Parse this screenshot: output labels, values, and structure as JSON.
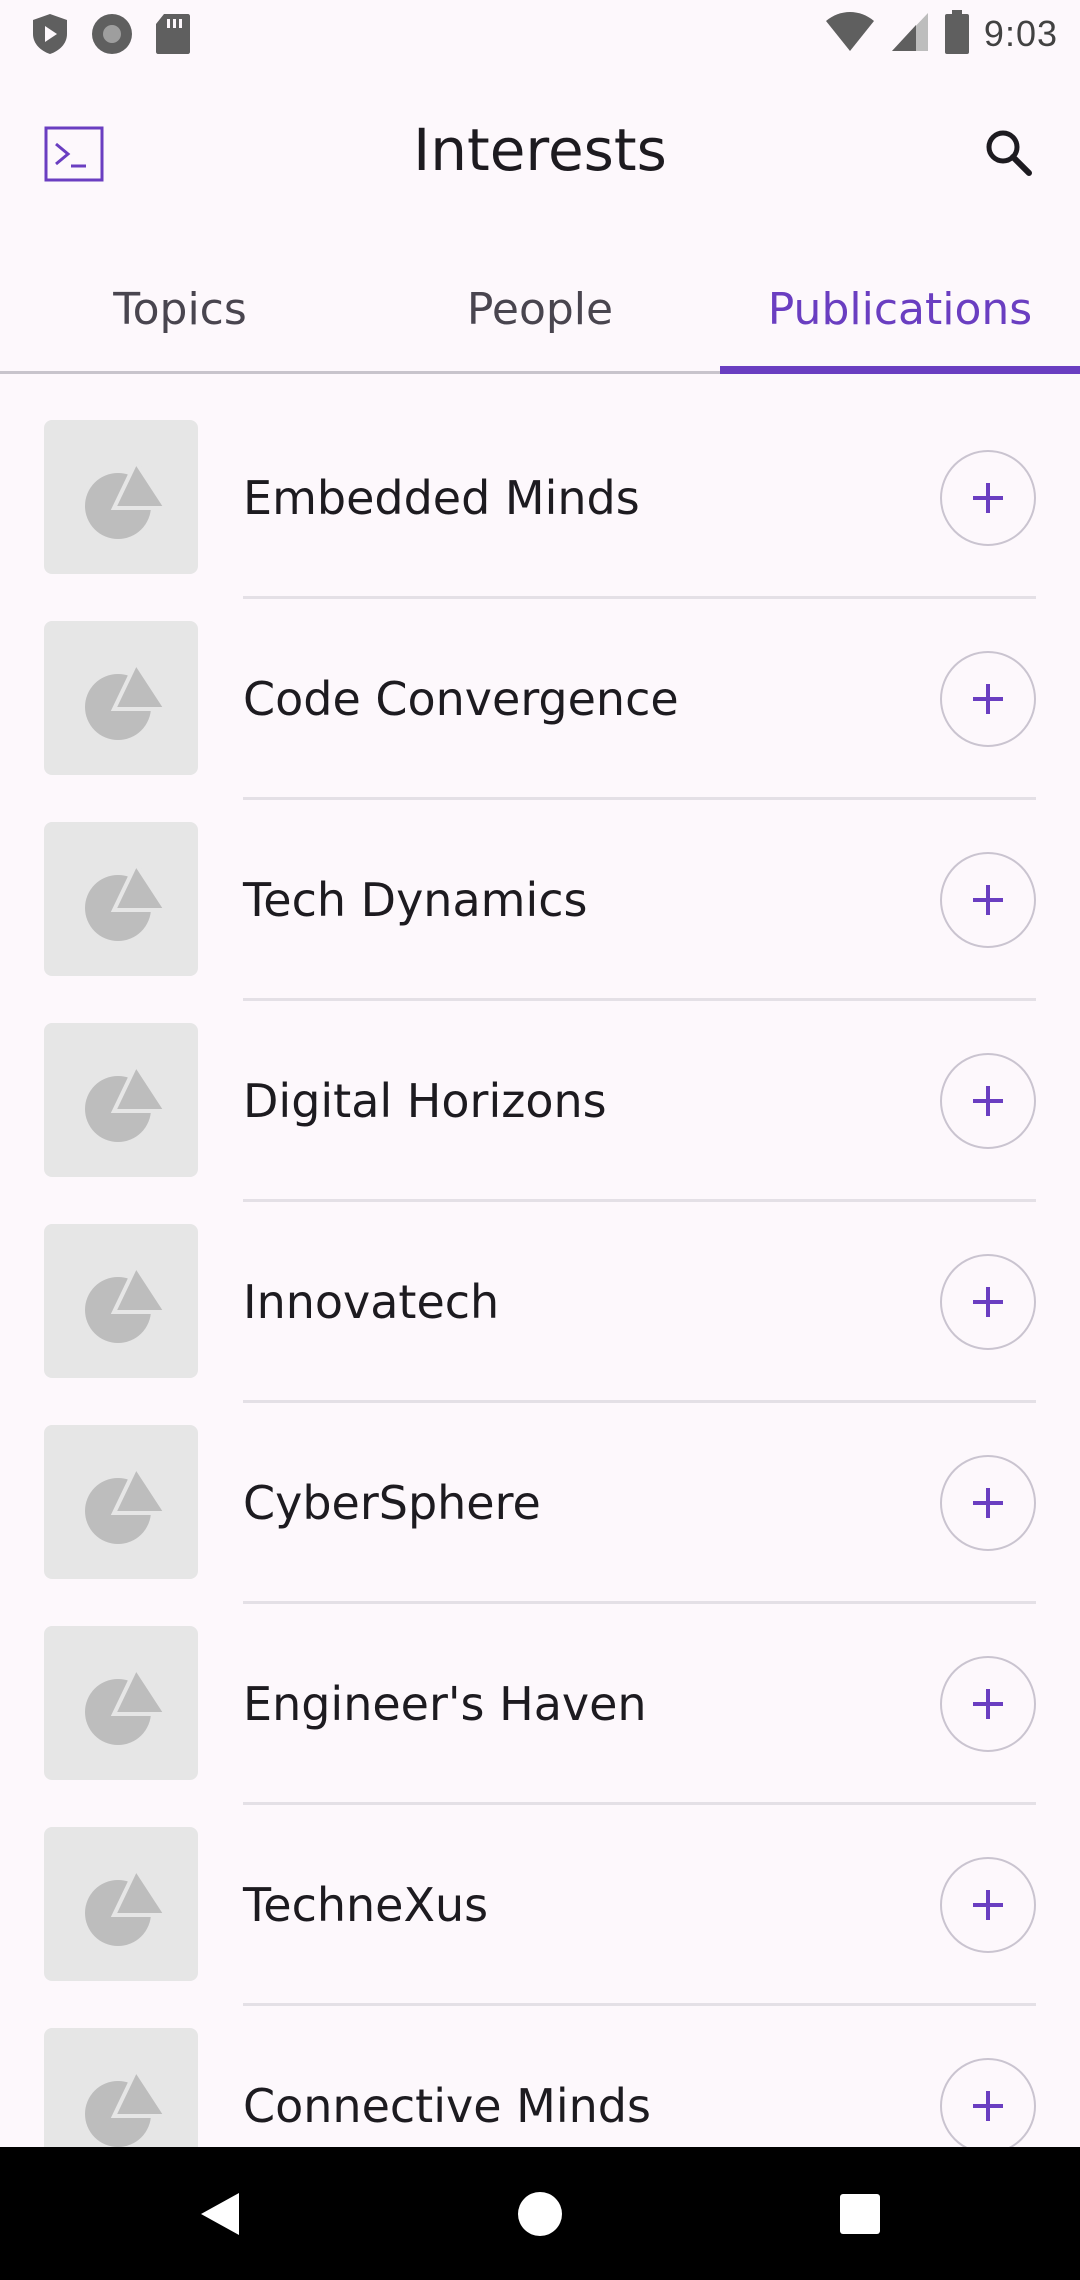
{
  "status_bar": {
    "time": "9:03",
    "left_icons": [
      "shield-play-icon",
      "circle-record-icon",
      "sd-card-icon"
    ],
    "right_icons": [
      "wifi-icon",
      "cell-signal-icon",
      "battery-icon"
    ]
  },
  "app_bar": {
    "title": "Interests",
    "nav_icon": "terminal-icon",
    "action_icon": "search-icon"
  },
  "tabs": [
    {
      "label": "Topics",
      "selected": false
    },
    {
      "label": "People",
      "selected": false
    },
    {
      "label": "Publications",
      "selected": true
    }
  ],
  "publications": [
    {
      "name": "Embedded Minds",
      "action": "plus-icon"
    },
    {
      "name": "Code Convergence",
      "action": "plus-icon"
    },
    {
      "name": "Tech Dynamics",
      "action": "plus-icon"
    },
    {
      "name": "Digital Horizons",
      "action": "plus-icon"
    },
    {
      "name": "Innovatech",
      "action": "plus-icon"
    },
    {
      "name": "CyberSphere",
      "action": "plus-icon"
    },
    {
      "name": "Engineer's Haven",
      "action": "plus-icon"
    },
    {
      "name": "TechneXus",
      "action": "plus-icon"
    },
    {
      "name": "Connective Minds",
      "action": "plus-icon"
    }
  ],
  "colors": {
    "accent": "#6a3ec1",
    "background": "#fdf8fc",
    "thumb_bg": "#e6e6e6",
    "thumb_shape": "#bdbdbd",
    "text": "#1d1b20"
  },
  "nav_bar": {
    "buttons": [
      "back-icon",
      "home-icon",
      "recents-icon"
    ]
  }
}
